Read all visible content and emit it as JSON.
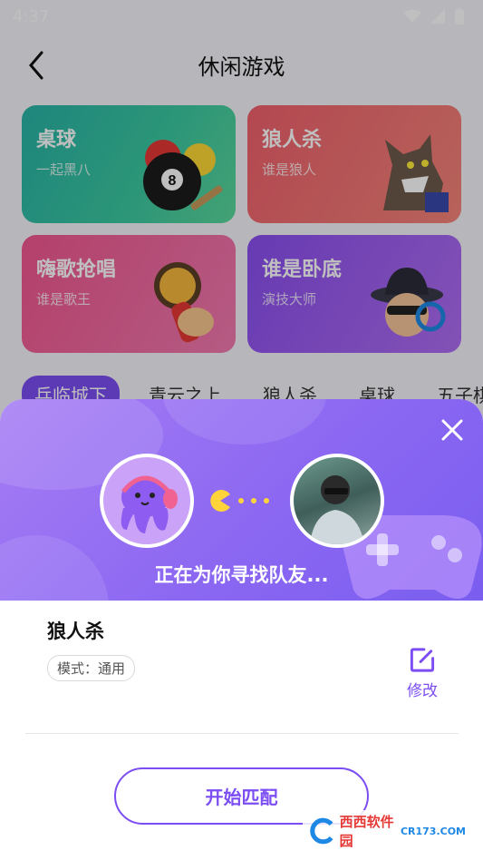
{
  "statusbar": {
    "time": "4:37"
  },
  "nav": {
    "title": "休闲游戏"
  },
  "games": [
    {
      "title": "桌球",
      "subtitle": "一起黑八"
    },
    {
      "title": "狼人杀",
      "subtitle": "谁是狼人"
    },
    {
      "title": "嗨歌抢唱",
      "subtitle": "谁是歌王"
    },
    {
      "title": "谁是卧底",
      "subtitle": "演技大师"
    }
  ],
  "tabs": [
    "乒临城下",
    "青云之上",
    "狼人杀",
    "桌球",
    "五子棋"
  ],
  "sheet": {
    "matching_text": "正在为你寻找队友...",
    "game_name": "狼人杀",
    "mode_label": "模式：通用",
    "edit_label": "修改",
    "start_button": "开始匹配"
  },
  "watermark": {
    "text": "西西软件园",
    "site": "CR173.COM"
  },
  "colors": {
    "accent": "#7b4df2",
    "header_gradient_start": "#a57cf4",
    "header_gradient_end": "#7a5ef0"
  }
}
